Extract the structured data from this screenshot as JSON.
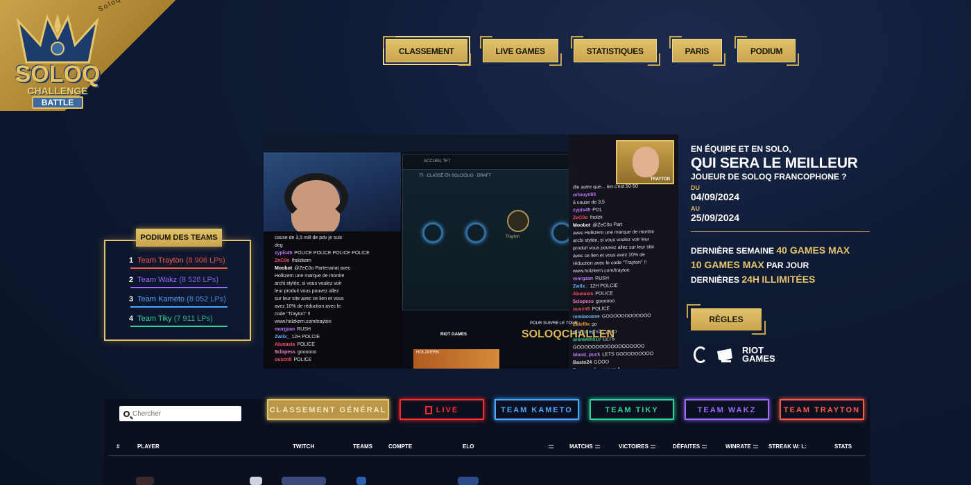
{
  "brand": {
    "ribbon_text": "Soloq Challenge Battle",
    "logo_line1": "SOLOQ",
    "logo_line2": "CHALLENGE",
    "logo_line3": "BATTLE"
  },
  "nav": [
    {
      "label": "CLASSEMENT",
      "active": true
    },
    {
      "label": "LIVE GAMES"
    },
    {
      "label": "STATISTIQUES"
    },
    {
      "label": "PARIS"
    },
    {
      "label": "PODIUM"
    }
  ],
  "podium": {
    "title": "PODIUM DES TEAMS",
    "teams": [
      {
        "rank": "1",
        "name": "Team Trayton",
        "lp": "(8 906 LPs)",
        "color": "#ff5a4a"
      },
      {
        "rank": "2",
        "name": "Team Wakz",
        "lp": "(8 526 LPs)",
        "color": "#9b6bff"
      },
      {
        "rank": "3",
        "name": "Team Kameto",
        "lp": "(8 052 LPs)",
        "color": "#4aa8ff"
      },
      {
        "rank": "4",
        "name": "Team Tiky",
        "lp": "(7 911 LPs)",
        "color": "#2fd49a"
      }
    ]
  },
  "stream": {
    "client_bar": "ACCUEIL   TFT",
    "client_mode": "FI · CLASSÉ EN SOLO/DUO · DRAFT",
    "champ_name": "Trayton",
    "cam_name": "TRAYTON",
    "overlay_small": "POUR SUIVRE LE TOUR",
    "overlay_brand": "SOLOQCHALLEN",
    "riot_mini": "RIOT GAMES",
    "thumb_text": "HOLZKERN",
    "chat_left": [
      {
        "name": "",
        "msg": "cause de 3,5 mill de pdv je suis",
        "color": "#ddd"
      },
      {
        "name": "",
        "msg": "deg",
        "color": "#ddd"
      },
      {
        "name": "zypis45",
        "msg": "POLICE POLICE POLICE POLICE",
        "color": "#c07bff"
      },
      {
        "name": "ZeC0o",
        "msg": "!holzkern",
        "color": "#ff4d6d"
      },
      {
        "name": "Moobot",
        "msg": "@ZeC0o Partenariat avec",
        "color": "#fff"
      },
      {
        "name": "",
        "msg": "Holkzern une marque de montre",
        "color": "#ddd"
      },
      {
        "name": "",
        "msg": "archi stylée, si vous voulez voir",
        "color": "#ddd"
      },
      {
        "name": "",
        "msg": "leur produit vous pouvez allez",
        "color": "#ddd"
      },
      {
        "name": "",
        "msg": "sur leur site avec ce lien et vous",
        "color": "#ddd"
      },
      {
        "name": "",
        "msg": "avez 10% de réduction avec le",
        "color": "#ddd"
      },
      {
        "name": "",
        "msg": "code \"Trayton\" !!",
        "color": "#ddd"
      },
      {
        "name": "",
        "msg": "www.holzkern.com/trayton",
        "color": "#ddd"
      },
      {
        "name": "morgzan",
        "msg": "RUSH",
        "color": "#c07bff"
      },
      {
        "name": "Zwiix_",
        "msg": "12H POLCIE",
        "color": "#6fb6ff"
      },
      {
        "name": "Alunaxia",
        "msg": "POLICE",
        "color": "#ff4d6d"
      },
      {
        "name": "5clopess",
        "msg": "goooooo",
        "color": "#ff7fcf"
      },
      {
        "name": "ouscn5",
        "msg": "POLICE",
        "color": "#ff4d6d"
      }
    ],
    "chat_right": [
      {
        "name": "",
        "msg": "dle autre que... ien c'est 50-50",
        "color": "#ddd"
      },
      {
        "name": "orlouys93",
        "msg": "",
        "color": "#c07bff"
      },
      {
        "name": "",
        "msg": "à cause de 3,5",
        "color": "#ddd"
      },
      {
        "name": "zypis45",
        "msg": "POL",
        "color": "#c07bff"
      },
      {
        "name": "ZeC0o",
        "msg": "!holzk",
        "color": "#ff4d6d"
      },
      {
        "name": "Moobot",
        "msg": "@ZeC0o Part",
        "color": "#fff"
      },
      {
        "name": "",
        "msg": "avec Holkzern une marque de montre",
        "color": "#ddd"
      },
      {
        "name": "",
        "msg": "archi stylée, si vous voulez voir leur",
        "color": "#ddd"
      },
      {
        "name": "",
        "msg": "produit vous pouvez allez sur leur site",
        "color": "#ddd"
      },
      {
        "name": "",
        "msg": "avec ce lien et vous avez 10% de",
        "color": "#ddd"
      },
      {
        "name": "",
        "msg": "réduction avec le code \"Trayton\" !!",
        "color": "#ddd"
      },
      {
        "name": "",
        "msg": "www.holzkern.com/trayton",
        "color": "#ddd"
      },
      {
        "name": "morgzan",
        "msg": "RUSH",
        "color": "#c07bff"
      },
      {
        "name": "Zwiix_",
        "msg": "12H POLCIE",
        "color": "#6fb6ff"
      },
      {
        "name": "Alunaxia",
        "msg": "POLICE",
        "color": "#ff4d6d"
      },
      {
        "name": "5clopess",
        "msg": "goooooo",
        "color": "#ff7fcf"
      },
      {
        "name": "ouscn5",
        "msg": "POLICE",
        "color": "#ff4d6d"
      },
      {
        "name": "remiaousse",
        "msg": "GOOOOOOOOOOOO",
        "color": "#6fb6ff"
      },
      {
        "name": "Zeleflix",
        "msg": "go",
        "color": "#ff9f43"
      },
      {
        "name": "magicregis70",
        "msg": "gooo",
        "color": "#6fb6ff"
      },
      {
        "name": "arenwen010",
        "msg": "LETS",
        "color": "#2fd49a"
      },
      {
        "name": "",
        "msg": "GOOOOOOOOOOOOOOOOOO",
        "color": "#ddd"
      },
      {
        "name": "blood_puck",
        "msg": "LETS GOOOOOOOOO",
        "color": "#c07bff"
      },
      {
        "name": "Basto24",
        "msg": "GOOO",
        "color": "#ddd"
      },
      {
        "name": "Ragenord_",
        "msg": "gmo va b...",
        "color": "#ddd"
      }
    ]
  },
  "info": {
    "line1": "EN ÉQUIPE ET EN SOLO,",
    "headline": "QUI SERA LE MEILLEUR",
    "line3": "JOUEUR DE SOLOQ FRANCOPHONE ?",
    "du_label": "DU",
    "date_start": "04/09/2024",
    "au_label": "AU",
    "date_end": "25/09/2024",
    "rule1_a": "DERNIÈRE SEMAINE",
    "rule1_b": "40 GAMES MAX",
    "rule2_a": "10 GAMES MAX",
    "rule2_b": "PAR JOUR",
    "rule3_a": "DERNIÈRES",
    "rule3_b": "24H",
    "rule3_c": "ILLIMITÉES",
    "regles_label": "RÈGLES",
    "riot_line1": "RIOT",
    "riot_line2": "GAMES"
  },
  "search": {
    "placeholder": "Chercher",
    "value": ""
  },
  "tabs": [
    {
      "label": "CLASSEMENT GÉNÉRAL",
      "color": "#e5c66c",
      "bg": "#b99648",
      "width": 176
    },
    {
      "label": "LIVE",
      "color": "#ff2a2a",
      "width": 122
    },
    {
      "label": "TEAM KAMETO",
      "color": "#4aa8ff",
      "width": 122
    },
    {
      "label": "TEAM TIKY",
      "color": "#2fd49a",
      "width": 122
    },
    {
      "label": "TEAM WAKZ",
      "color": "#9b6bff",
      "width": 122
    },
    {
      "label": "TEAM TRAYTON",
      "color": "#ff5a4a",
      "width": 122
    }
  ],
  "table": {
    "headers": {
      "rank": "#",
      "player": "PLAYER",
      "twitch": "TWITCH",
      "teams": "TEAMS",
      "compte": "COMPTE",
      "elo": "ELO",
      "matchs": "MATCHS",
      "victoires": "VICTOIRES",
      "defaites": "DÉFAITES",
      "winrate": "WINRATE",
      "streak": "STREAK W: L:",
      "stats": "STATS"
    }
  },
  "colors": {
    "gold": "#e5c66c",
    "bg": "#0f1a33"
  }
}
